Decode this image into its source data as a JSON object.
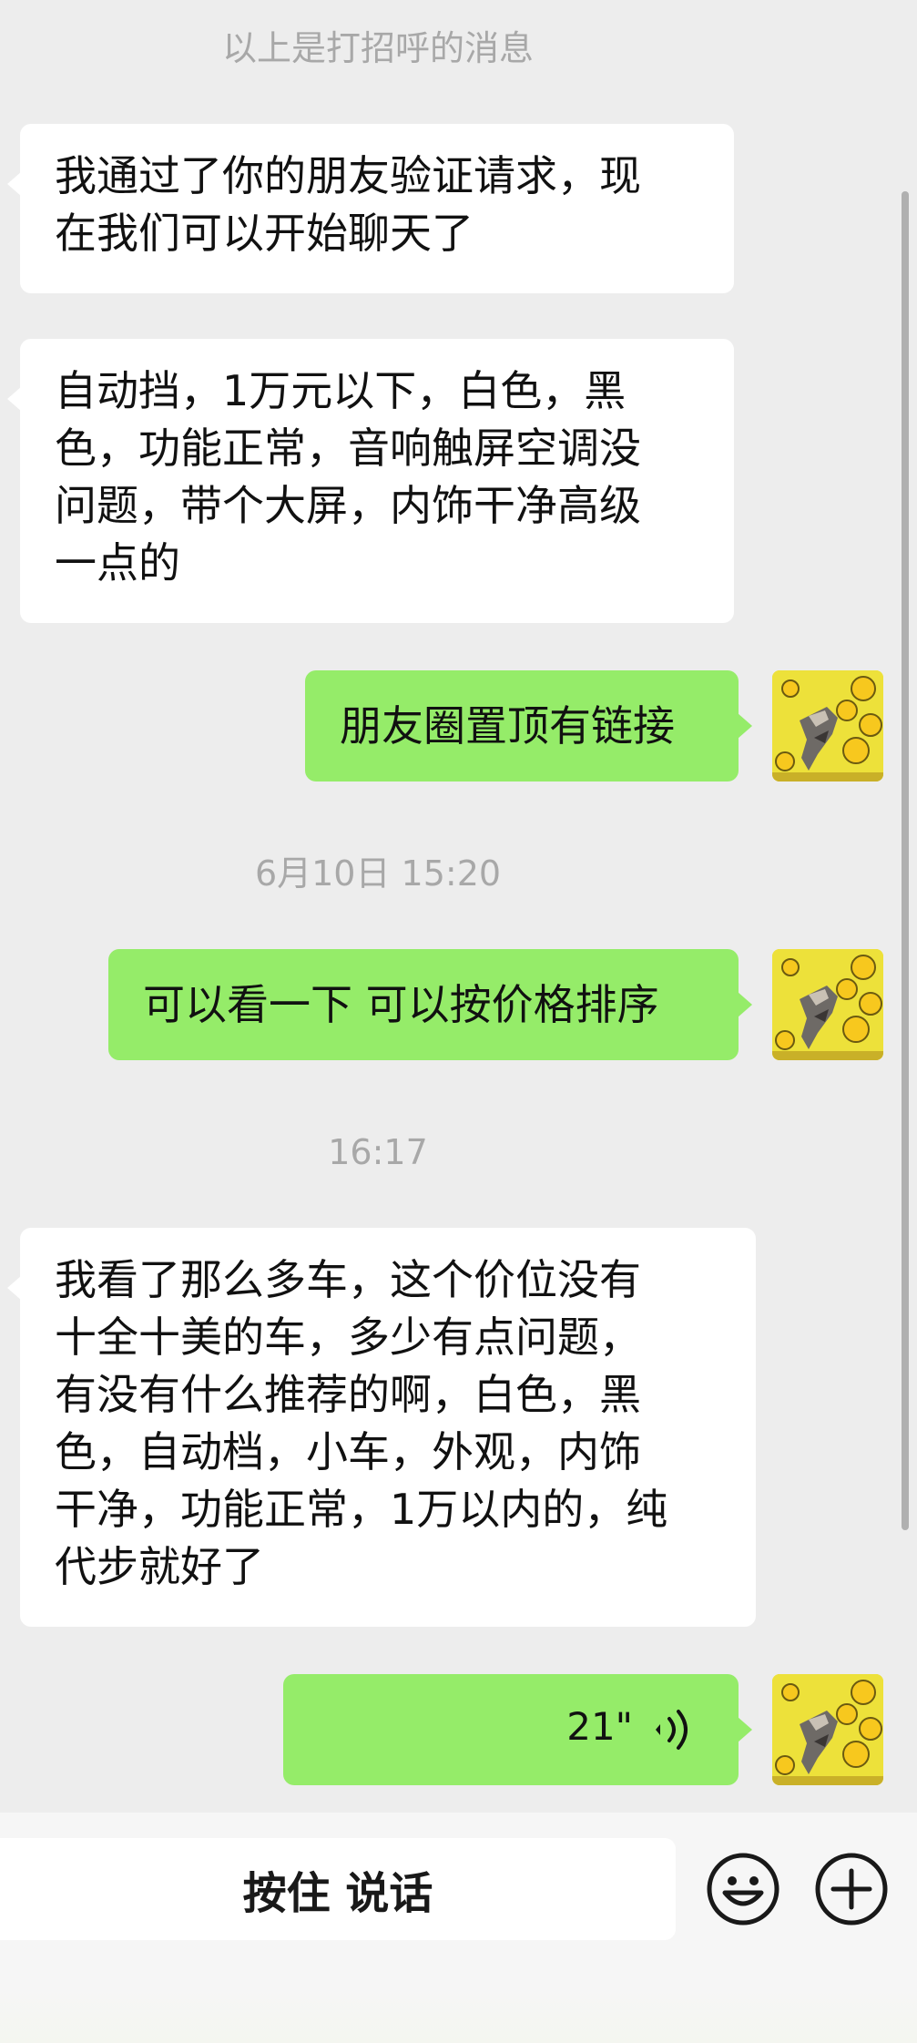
{
  "chat": {
    "system_notice": "以上是打招呼的消息",
    "messages": [
      {
        "direction": "in",
        "text": "我通过了你的朋友验证请求，现\n在我们可以开始聊天了"
      },
      {
        "direction": "in",
        "text": "自动挡，1万元以下，白色，黑\n色，功能正常，音响触屏空调没\n问题，带个大屏，内饰干净高级\n一点的"
      },
      {
        "direction": "out",
        "text": "朋友圈置顶有链接"
      },
      {
        "direction": "out",
        "text": "可以看一下 可以按价格排序"
      },
      {
        "direction": "in",
        "text": "我看了那么多车，这个价位没有\n十全十美的车，多少有点问题，\n有没有什么推荐的啊，白色，黑\n色，自动档，小车，外观，内饰\n干净，功能正常，1万以内的，纯\n代步就好了"
      },
      {
        "direction": "out",
        "type": "voice",
        "duration": "21\""
      }
    ],
    "timestamps": {
      "t1": "6月10日 15:20",
      "t2": "16:17"
    }
  },
  "input_bar": {
    "hold_to_talk_label": "按住 说话",
    "emoji_icon": "emoji-icon",
    "plus_icon": "plus-icon"
  },
  "colors": {
    "background": "#ededed",
    "outgoing_bubble": "#95ec69",
    "incoming_bubble": "#ffffff",
    "timestamp_text": "#a8a8a8"
  }
}
